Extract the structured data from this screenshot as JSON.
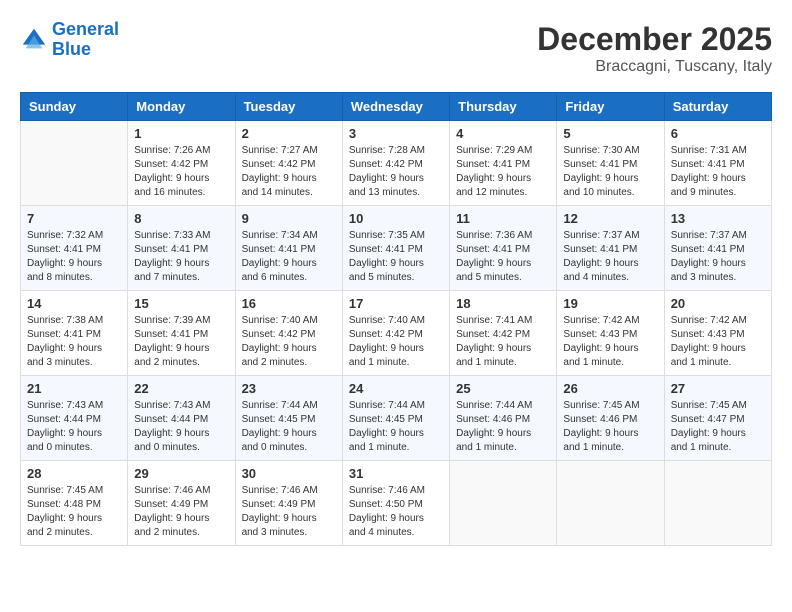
{
  "header": {
    "logo_line1": "General",
    "logo_line2": "Blue",
    "month": "December 2025",
    "location": "Braccagni, Tuscany, Italy"
  },
  "days_of_week": [
    "Sunday",
    "Monday",
    "Tuesday",
    "Wednesday",
    "Thursday",
    "Friday",
    "Saturday"
  ],
  "weeks": [
    [
      {
        "day": "",
        "info": ""
      },
      {
        "day": "1",
        "info": "Sunrise: 7:26 AM\nSunset: 4:42 PM\nDaylight: 9 hours\nand 16 minutes."
      },
      {
        "day": "2",
        "info": "Sunrise: 7:27 AM\nSunset: 4:42 PM\nDaylight: 9 hours\nand 14 minutes."
      },
      {
        "day": "3",
        "info": "Sunrise: 7:28 AM\nSunset: 4:42 PM\nDaylight: 9 hours\nand 13 minutes."
      },
      {
        "day": "4",
        "info": "Sunrise: 7:29 AM\nSunset: 4:41 PM\nDaylight: 9 hours\nand 12 minutes."
      },
      {
        "day": "5",
        "info": "Sunrise: 7:30 AM\nSunset: 4:41 PM\nDaylight: 9 hours\nand 10 minutes."
      },
      {
        "day": "6",
        "info": "Sunrise: 7:31 AM\nSunset: 4:41 PM\nDaylight: 9 hours\nand 9 minutes."
      }
    ],
    [
      {
        "day": "7",
        "info": "Sunrise: 7:32 AM\nSunset: 4:41 PM\nDaylight: 9 hours\nand 8 minutes."
      },
      {
        "day": "8",
        "info": "Sunrise: 7:33 AM\nSunset: 4:41 PM\nDaylight: 9 hours\nand 7 minutes."
      },
      {
        "day": "9",
        "info": "Sunrise: 7:34 AM\nSunset: 4:41 PM\nDaylight: 9 hours\nand 6 minutes."
      },
      {
        "day": "10",
        "info": "Sunrise: 7:35 AM\nSunset: 4:41 PM\nDaylight: 9 hours\nand 5 minutes."
      },
      {
        "day": "11",
        "info": "Sunrise: 7:36 AM\nSunset: 4:41 PM\nDaylight: 9 hours\nand 5 minutes."
      },
      {
        "day": "12",
        "info": "Sunrise: 7:37 AM\nSunset: 4:41 PM\nDaylight: 9 hours\nand 4 minutes."
      },
      {
        "day": "13",
        "info": "Sunrise: 7:37 AM\nSunset: 4:41 PM\nDaylight: 9 hours\nand 3 minutes."
      }
    ],
    [
      {
        "day": "14",
        "info": "Sunrise: 7:38 AM\nSunset: 4:41 PM\nDaylight: 9 hours\nand 3 minutes."
      },
      {
        "day": "15",
        "info": "Sunrise: 7:39 AM\nSunset: 4:41 PM\nDaylight: 9 hours\nand 2 minutes."
      },
      {
        "day": "16",
        "info": "Sunrise: 7:40 AM\nSunset: 4:42 PM\nDaylight: 9 hours\nand 2 minutes."
      },
      {
        "day": "17",
        "info": "Sunrise: 7:40 AM\nSunset: 4:42 PM\nDaylight: 9 hours\nand 1 minute."
      },
      {
        "day": "18",
        "info": "Sunrise: 7:41 AM\nSunset: 4:42 PM\nDaylight: 9 hours\nand 1 minute."
      },
      {
        "day": "19",
        "info": "Sunrise: 7:42 AM\nSunset: 4:43 PM\nDaylight: 9 hours\nand 1 minute."
      },
      {
        "day": "20",
        "info": "Sunrise: 7:42 AM\nSunset: 4:43 PM\nDaylight: 9 hours\nand 1 minute."
      }
    ],
    [
      {
        "day": "21",
        "info": "Sunrise: 7:43 AM\nSunset: 4:44 PM\nDaylight: 9 hours\nand 0 minutes."
      },
      {
        "day": "22",
        "info": "Sunrise: 7:43 AM\nSunset: 4:44 PM\nDaylight: 9 hours\nand 0 minutes."
      },
      {
        "day": "23",
        "info": "Sunrise: 7:44 AM\nSunset: 4:45 PM\nDaylight: 9 hours\nand 0 minutes."
      },
      {
        "day": "24",
        "info": "Sunrise: 7:44 AM\nSunset: 4:45 PM\nDaylight: 9 hours\nand 1 minute."
      },
      {
        "day": "25",
        "info": "Sunrise: 7:44 AM\nSunset: 4:46 PM\nDaylight: 9 hours\nand 1 minute."
      },
      {
        "day": "26",
        "info": "Sunrise: 7:45 AM\nSunset: 4:46 PM\nDaylight: 9 hours\nand 1 minute."
      },
      {
        "day": "27",
        "info": "Sunrise: 7:45 AM\nSunset: 4:47 PM\nDaylight: 9 hours\nand 1 minute."
      }
    ],
    [
      {
        "day": "28",
        "info": "Sunrise: 7:45 AM\nSunset: 4:48 PM\nDaylight: 9 hours\nand 2 minutes."
      },
      {
        "day": "29",
        "info": "Sunrise: 7:46 AM\nSunset: 4:49 PM\nDaylight: 9 hours\nand 2 minutes."
      },
      {
        "day": "30",
        "info": "Sunrise: 7:46 AM\nSunset: 4:49 PM\nDaylight: 9 hours\nand 3 minutes."
      },
      {
        "day": "31",
        "info": "Sunrise: 7:46 AM\nSunset: 4:50 PM\nDaylight: 9 hours\nand 4 minutes."
      },
      {
        "day": "",
        "info": ""
      },
      {
        "day": "",
        "info": ""
      },
      {
        "day": "",
        "info": ""
      }
    ]
  ]
}
